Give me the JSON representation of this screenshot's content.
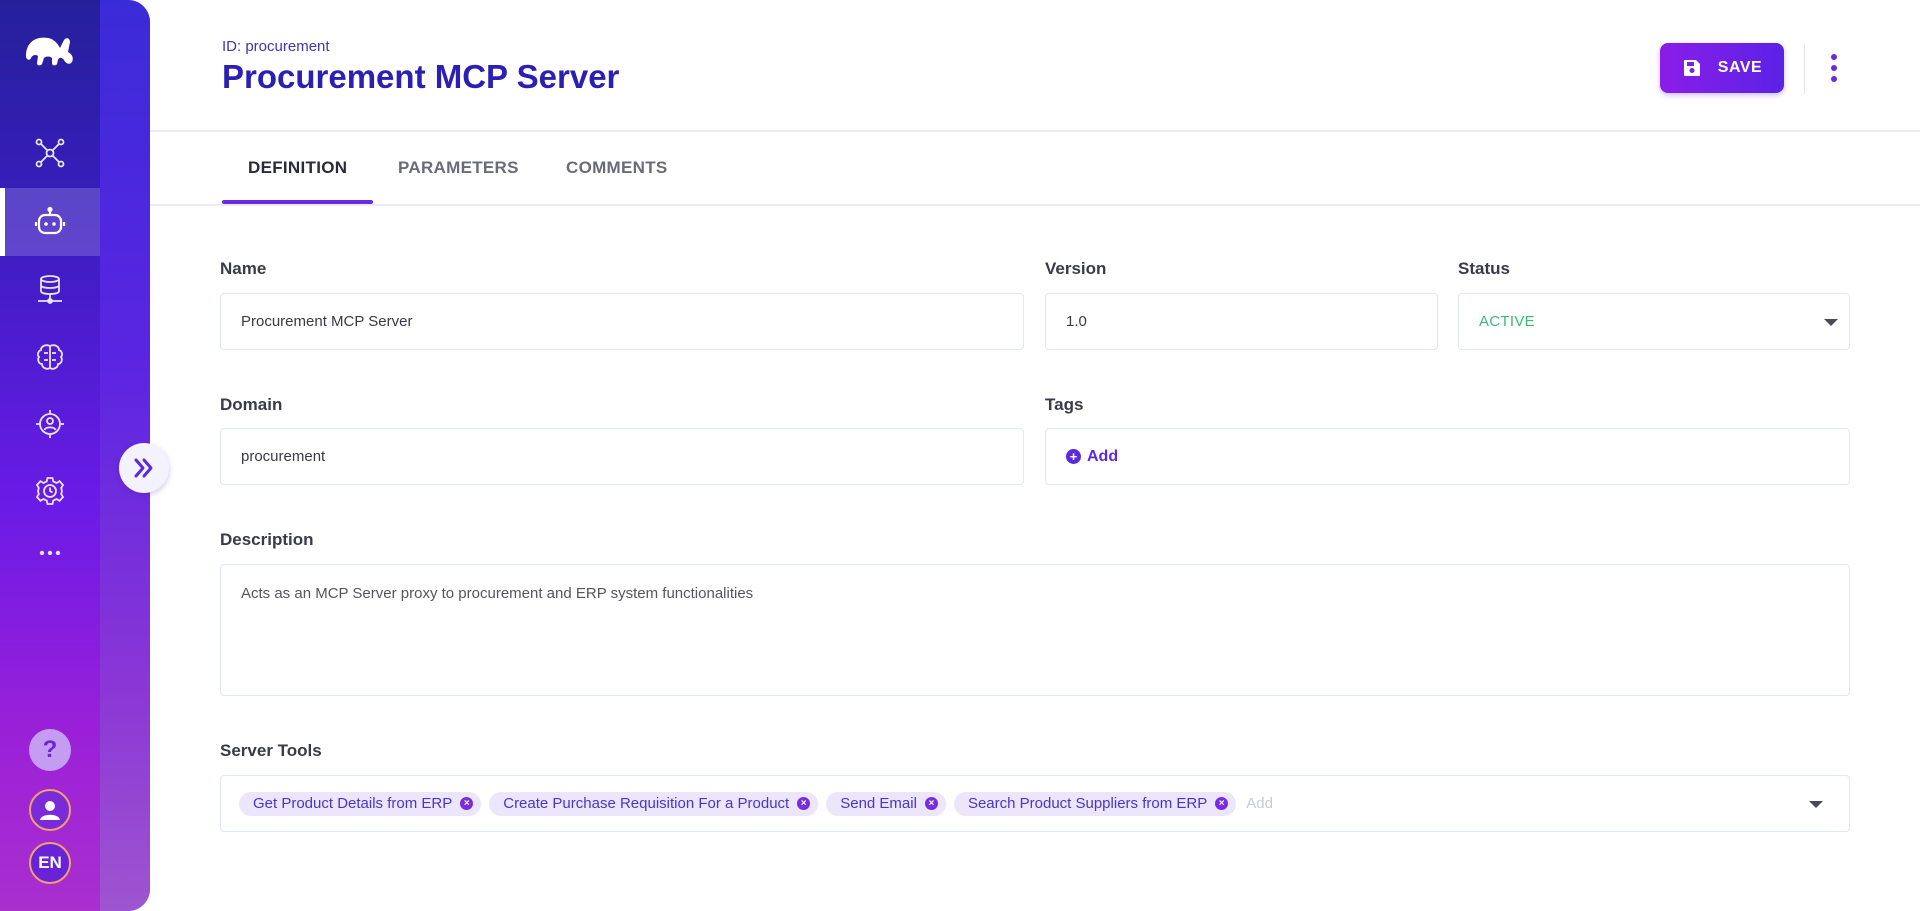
{
  "sidebar": {
    "nav": [
      {
        "icon": "network-icon",
        "active": false
      },
      {
        "icon": "robot-icon",
        "active": true
      },
      {
        "icon": "database-icon",
        "active": false
      },
      {
        "icon": "brain-icon",
        "active": false
      },
      {
        "icon": "target-user-icon",
        "active": false
      },
      {
        "icon": "gear-clock-icon",
        "active": false
      },
      {
        "icon": "more-dots-icon",
        "active": false
      }
    ],
    "help_label": "?",
    "language": "EN"
  },
  "header": {
    "id_line": "ID: procurement",
    "title": "Procurement MCP Server",
    "save_label": "SAVE"
  },
  "tabs": [
    {
      "label": "DEFINITION",
      "active": true
    },
    {
      "label": "PARAMETERS",
      "active": false
    },
    {
      "label": "COMMENTS",
      "active": false
    }
  ],
  "form": {
    "name": {
      "label": "Name",
      "value": "Procurement MCP Server"
    },
    "version": {
      "label": "Version",
      "value": "1.0"
    },
    "status": {
      "label": "Status",
      "value": "ACTIVE"
    },
    "domain": {
      "label": "Domain",
      "value": "procurement"
    },
    "tags": {
      "label": "Tags",
      "add_label": "Add"
    },
    "description": {
      "label": "Description",
      "value": "Acts as an MCP Server proxy to procurement and ERP system functionalities"
    },
    "server_tools": {
      "label": "Server Tools",
      "items": [
        "Get Product Details from ERP",
        "Create Purchase Requisition For a Product",
        "Send Email",
        "Search Product Suppliers from ERP"
      ],
      "add_placeholder": "Add"
    }
  },
  "colors": {
    "accent": "#6a2ae0",
    "title": "#2b1fb4",
    "status_active": "#3cb878"
  }
}
